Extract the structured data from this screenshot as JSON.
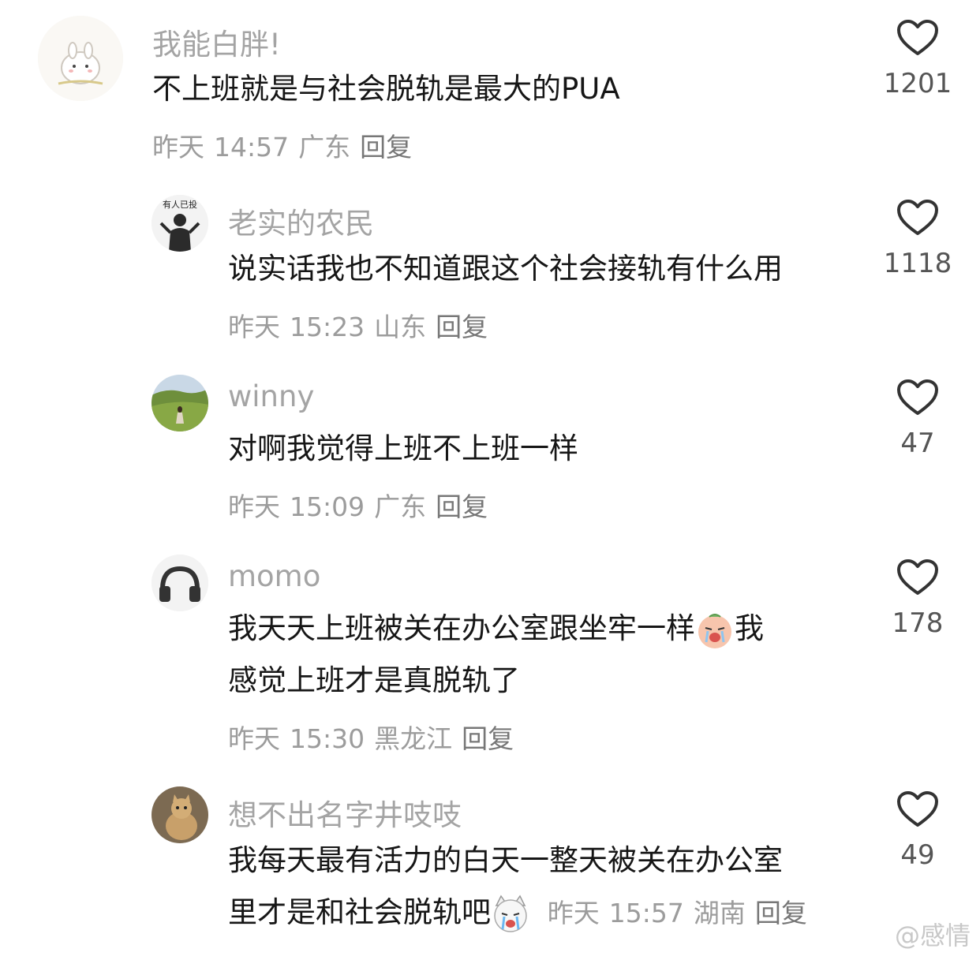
{
  "comments": [
    {
      "name": "我能白胖!",
      "text": "不上班就是与社会脱轨是最大的PUA",
      "date": "昨天",
      "time": "14:57",
      "loc": "广东",
      "reply": "回复",
      "likes": "1201"
    },
    {
      "name": "老实的农民",
      "avatar_text": "有人已投",
      "text": "说实话我也不知道跟这个社会接轨有什么用",
      "date": "昨天",
      "time": "15:23",
      "loc": "山东",
      "reply": "回复",
      "likes": "1118"
    },
    {
      "name": "winny",
      "text": "对啊我觉得上班不上班一样",
      "date": "昨天",
      "time": "15:09",
      "loc": "广东",
      "reply": "回复",
      "likes": "47"
    },
    {
      "name": "momo",
      "text_1a": "我天天上班被关在办公室跟坐牢一样",
      "text_1b": "我",
      "text_2": "感觉上班才是真脱轨了",
      "date": "昨天",
      "time": "15:30",
      "loc": "黑龙江",
      "reply": "回复",
      "likes": "178"
    },
    {
      "name": "想不出名字井吱吱",
      "text_1": "我每天最有活力的白天一整天被关在办公室",
      "text_2": "里才是和社会脱轨吧",
      "date": "昨天",
      "time": "15:57",
      "loc": "湖南",
      "reply": "回复",
      "likes": "49"
    }
  ],
  "watermark": "@感情",
  "icons": {
    "like": "heart-outline-icon",
    "emoji_cry": "crying-face-emoji",
    "emoji_dog": "crying-dog-emoji"
  },
  "colors": {
    "name": "#a4a4a4",
    "text": "#161616",
    "meta": "#9c9c9c"
  }
}
